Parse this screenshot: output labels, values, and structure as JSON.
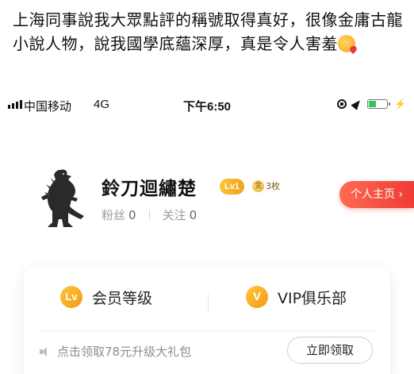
{
  "caption": {
    "text": "上海同事說我大眾點評的稱號取得真好，很像金庸古龍小說人物，說我國學底蘊深厚，真是令人害羞"
  },
  "statusbar": {
    "carrier": "中国移动",
    "network": "4G",
    "time": "下午6:50"
  },
  "profile": {
    "username": "鈴刀迴繡楚",
    "level_badge": "Lv1",
    "coin_icon_text": "金",
    "coin_count": "3枚",
    "followers_label": "粉丝",
    "followers_count": "0",
    "following_label": "关注",
    "following_count": "0",
    "homepage_button": "个人主页"
  },
  "card": {
    "member_icon": "Lv",
    "member_label": "会员等级",
    "vip_icon": "V",
    "vip_label": "VIP俱乐部",
    "promo_text": "点击领取78元升级大礼包",
    "claim_button": "立即领取"
  },
  "colors": {
    "accent_red": "#ef3b36",
    "gold": "#f2a21a",
    "battery_green": "#37c35a"
  }
}
